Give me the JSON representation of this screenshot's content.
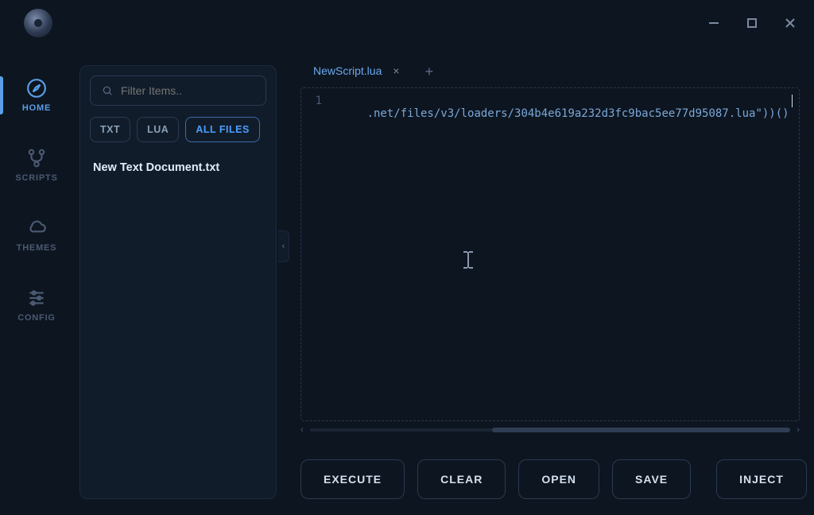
{
  "window": {
    "minimize": "—",
    "maximize": "□",
    "close": "×"
  },
  "sidebar": {
    "items": [
      {
        "label": "HOME",
        "icon": "compass-icon",
        "active": true
      },
      {
        "label": "SCRIPTS",
        "icon": "branch-icon",
        "active": false
      },
      {
        "label": "THEMES",
        "icon": "cloud-icon",
        "active": false
      },
      {
        "label": "CONFIG",
        "icon": "sliders-icon",
        "active": false
      }
    ]
  },
  "files_panel": {
    "search_placeholder": "Filter Items..",
    "filters": [
      {
        "label": "TXT",
        "active": false
      },
      {
        "label": "LUA",
        "active": false
      },
      {
        "label": "ALL FILES",
        "active": true
      }
    ],
    "items": [
      {
        "name": "New Text Document.txt"
      }
    ]
  },
  "collapse_glyph": "‹",
  "editor": {
    "tabs": [
      {
        "title": "NewScript.lua",
        "active": true
      }
    ],
    "add_tab": "+",
    "line_number": "1",
    "code_line": ".net/files/v3/loaders/304b4e619a232d3fc9bac5ee77d95087.lua\"))()",
    "scroll_left": "‹",
    "scroll_right": "›",
    "scroll_thumb_width_pct": 62
  },
  "actions": {
    "execute": "EXECUTE",
    "clear": "CLEAR",
    "open": "OPEN",
    "save": "SAVE",
    "inject": "INJECT"
  },
  "colors": {
    "bg": "#0d1520",
    "panel": "#111c2a",
    "accent": "#5b9ee6",
    "border": "#2a3a52"
  }
}
